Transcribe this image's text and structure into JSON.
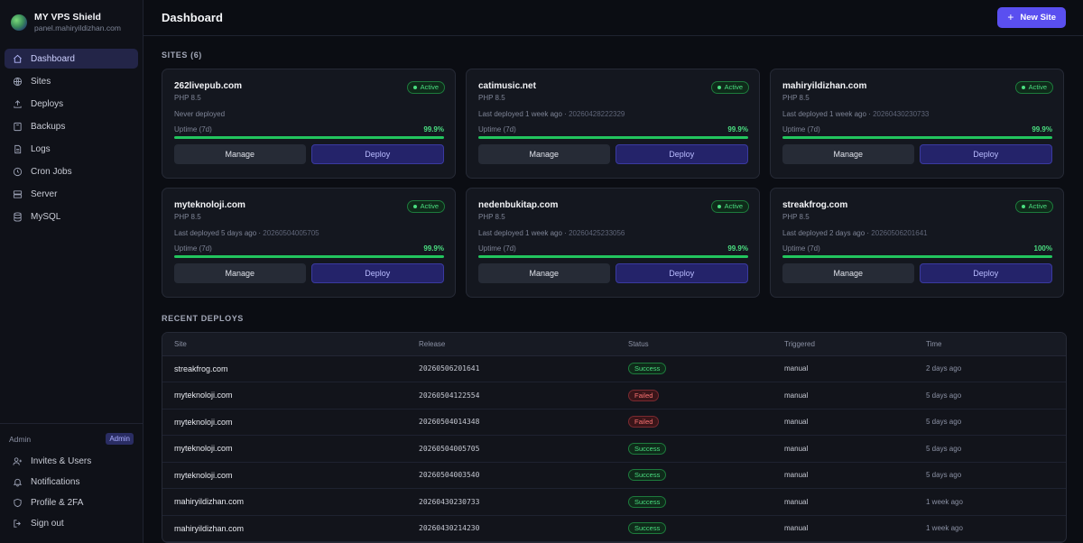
{
  "brand": {
    "title": "MY VPS Shield",
    "subtitle": "panel.mahiryildizhan.com"
  },
  "nav": [
    {
      "label": "Dashboard",
      "icon": "home-icon",
      "active": true
    },
    {
      "label": "Sites",
      "icon": "globe-icon"
    },
    {
      "label": "Deploys",
      "icon": "upload-icon"
    },
    {
      "label": "Backups",
      "icon": "archive-icon"
    },
    {
      "label": "Logs",
      "icon": "file-text-icon"
    },
    {
      "label": "Cron Jobs",
      "icon": "clock-icon"
    },
    {
      "label": "Server",
      "icon": "server-icon"
    },
    {
      "label": "MySQL",
      "icon": "database-icon"
    }
  ],
  "admin": {
    "label": "Admin",
    "badge": "Admin",
    "items": [
      {
        "label": "Invites & Users",
        "icon": "user-plus-icon"
      },
      {
        "label": "Notifications",
        "icon": "bell-icon"
      },
      {
        "label": "Profile & 2FA",
        "icon": "shield-icon"
      },
      {
        "label": "Sign out",
        "icon": "sign-out-icon"
      }
    ]
  },
  "header": {
    "title": "Dashboard",
    "new_site_label": "New Site"
  },
  "sites_title": "SITES (6)",
  "sites": [
    {
      "name": "262livepub.com",
      "php": "PHP 8.5",
      "deployed": "Never deployed",
      "hash": "",
      "status": "Active",
      "uptime_label": "Uptime (7d)",
      "uptime": "99.9%",
      "manage": "Manage",
      "deploy": "Deploy"
    },
    {
      "name": "catimusic.net",
      "php": "PHP 8.5",
      "deployed": "Last deployed 1 week ago · ",
      "hash": "20260428222329",
      "status": "Active",
      "uptime_label": "Uptime (7d)",
      "uptime": "99.9%",
      "manage": "Manage",
      "deploy": "Deploy"
    },
    {
      "name": "mahiryildizhan.com",
      "php": "PHP 8.5",
      "deployed": "Last deployed 1 week ago · ",
      "hash": "20260430230733",
      "status": "Active",
      "uptime_label": "Uptime (7d)",
      "uptime": "99.9%",
      "manage": "Manage",
      "deploy": "Deploy"
    },
    {
      "name": "myteknoloji.com",
      "php": "PHP 8.5",
      "deployed": "Last deployed 5 days ago · ",
      "hash": "20260504005705",
      "status": "Active",
      "uptime_label": "Uptime (7d)",
      "uptime": "99.9%",
      "manage": "Manage",
      "deploy": "Deploy"
    },
    {
      "name": "nedenbukitap.com",
      "php": "PHP 8.5",
      "deployed": "Last deployed 1 week ago · ",
      "hash": "20260425233056",
      "status": "Active",
      "uptime_label": "Uptime (7d)",
      "uptime": "99.9%",
      "manage": "Manage",
      "deploy": "Deploy"
    },
    {
      "name": "streakfrog.com",
      "php": "PHP 8.5",
      "deployed": "Last deployed 2 days ago · ",
      "hash": "20260506201641",
      "status": "Active",
      "uptime_label": "Uptime (7d)",
      "uptime": "100%",
      "manage": "Manage",
      "deploy": "Deploy"
    }
  ],
  "recent_title": "RECENT DEPLOYS",
  "table": {
    "headers": [
      "Site",
      "Release",
      "Status",
      "Triggered",
      "Time"
    ],
    "rows": [
      {
        "site": "streakfrog.com",
        "release": "20260506201641",
        "status": "Success",
        "triggered": "manual",
        "time": "2 days ago"
      },
      {
        "site": "myteknoloji.com",
        "release": "20260504122554",
        "status": "Failed",
        "triggered": "manual",
        "time": "5 days ago"
      },
      {
        "site": "myteknoloji.com",
        "release": "20260504014348",
        "status": "Failed",
        "triggered": "manual",
        "time": "5 days ago"
      },
      {
        "site": "myteknoloji.com",
        "release": "20260504005705",
        "status": "Success",
        "triggered": "manual",
        "time": "5 days ago"
      },
      {
        "site": "myteknoloji.com",
        "release": "20260504003540",
        "status": "Success",
        "triggered": "manual",
        "time": "5 days ago"
      },
      {
        "site": "mahiryildizhan.com",
        "release": "20260430230733",
        "status": "Success",
        "triggered": "manual",
        "time": "1 week ago"
      },
      {
        "site": "mahiryildizhan.com",
        "release": "20260430214230",
        "status": "Success",
        "triggered": "manual",
        "time": "1 week ago"
      }
    ]
  },
  "colors": {
    "accent": "#5a4ff0",
    "success": "#4ade80",
    "failed": "#f87171",
    "background": "#0b0d13"
  }
}
